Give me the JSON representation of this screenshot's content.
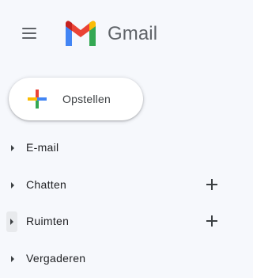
{
  "app": {
    "name": "Gmail",
    "logo_icon": "gmail-m-logo",
    "menu_icon": "hamburger-menu-icon"
  },
  "compose": {
    "label": "Opstellen",
    "icon": "colorful-plus-icon"
  },
  "nav": {
    "items": [
      {
        "label": "E-mail",
        "has_add": false,
        "expand_icon": "caret-right-icon"
      },
      {
        "label": "Chatten",
        "has_add": true,
        "add_icon": "plus-icon",
        "expand_icon": "caret-right-icon"
      },
      {
        "label": "Ruimten",
        "has_add": true,
        "add_icon": "plus-icon",
        "expand_icon": "caret-right-icon",
        "focused": true
      },
      {
        "label": "Vergaderen",
        "has_add": false,
        "expand_icon": "caret-right-icon"
      }
    ]
  },
  "colors": {
    "background": "#f6f8fc",
    "compose_bg": "#ffffff",
    "gmail_red": "#ea4335",
    "gmail_blue": "#4285f4",
    "gmail_green": "#34a853",
    "gmail_yellow": "#fbbc04",
    "gmail_darkred": "#c5221f",
    "text_primary": "#202124",
    "icon_gray": "#5f6368"
  }
}
